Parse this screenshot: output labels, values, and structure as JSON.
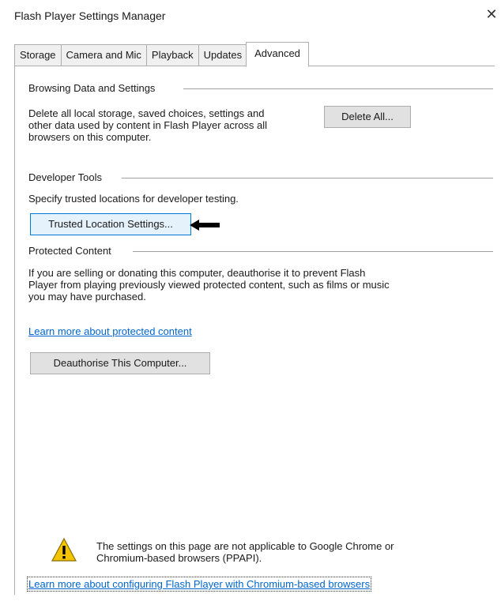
{
  "window": {
    "title": "Flash Player Settings Manager",
    "close_glyph": "✕"
  },
  "tabs": [
    {
      "label": "Storage"
    },
    {
      "label": "Camera and Mic"
    },
    {
      "label": "Playback"
    },
    {
      "label": "Updates"
    },
    {
      "label": "Advanced",
      "active": true
    }
  ],
  "browsing": {
    "title": "Browsing Data and Settings",
    "description_lines": [
      "Delete all local storage, saved choices, settings and",
      "other data used by content in Flash Player across all",
      "browsers on this computer."
    ],
    "delete_button": "Delete All..."
  },
  "developer": {
    "title": "Developer Tools",
    "description": "Specify trusted locations for developer testing.",
    "trusted_button": "Trusted Location Settings..."
  },
  "protected": {
    "title": "Protected Content",
    "description_lines": [
      "If you are selling or donating this computer, deauthorise it to prevent Flash",
      "Player from playing previously viewed protected content, such as films or music",
      "you may have purchased."
    ],
    "learn_link": "Learn more about protected content",
    "deauthorise_button": "Deauthorise This Computer..."
  },
  "notice": {
    "lines": [
      "The settings on this page are not applicable to Google Chrome or",
      "Chromium-based browsers (PPAPI)."
    ],
    "link": "Learn more about configuring Flash Player with Chromium-based browsers"
  },
  "colors": {
    "link": "#0066cc",
    "warning": "#f5c400"
  }
}
